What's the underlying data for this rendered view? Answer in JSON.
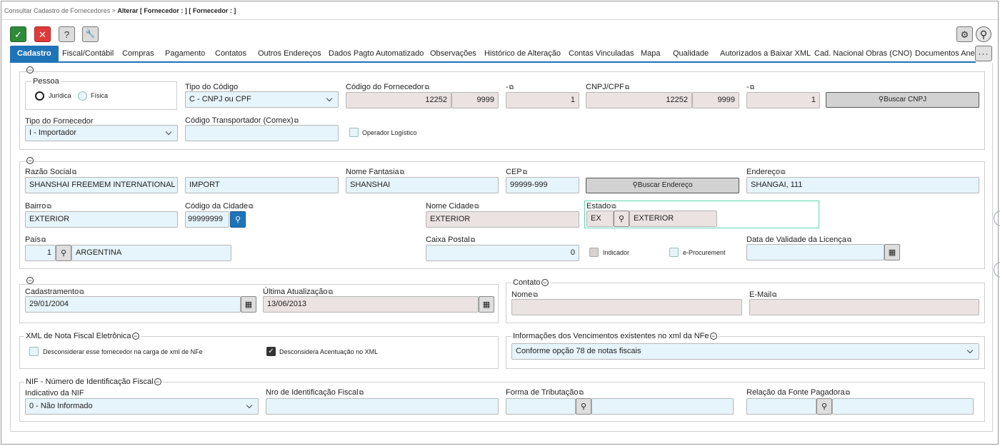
{
  "breadcrumb": {
    "parent": "Consultar Cadastro de Fornecedores",
    "separator": ">",
    "current": "Alterar [ Fornecedor : ] [ Fornecedor : ]"
  },
  "toolbar": {
    "confirm_glyph": "✓",
    "cancel_glyph": "✕",
    "help_glyph": "?",
    "tools_glyph": "🔧",
    "settings_glyph": "⚙",
    "search_glyph": "⚲"
  },
  "tabs": [
    {
      "label": "Cadastro",
      "active": true
    },
    {
      "label": "Fiscal/Contábil"
    },
    {
      "label": "Compras"
    },
    {
      "label": "Pagamento"
    },
    {
      "label": "Contatos"
    },
    {
      "label": "Outros Endereços"
    },
    {
      "label": "Dados Pagto Automatizado"
    },
    {
      "label": "Observações"
    },
    {
      "label": "Histórico de Alteração"
    },
    {
      "label": "Contas Vinculadas"
    },
    {
      "label": "Mapa"
    },
    {
      "label": "Qualidade"
    },
    {
      "label": "Autorizados a Baixar XML"
    },
    {
      "label": "Cad. Nacional Obras (CNO)"
    },
    {
      "label": "Documentos Anexo"
    }
  ],
  "tab_more": "···",
  "pessoa": {
    "title": "Pessoa",
    "juridica": "Jurídica",
    "fisica": "Física"
  },
  "tipo_codigo": {
    "label": "Tipo do Código",
    "value": "C - CNPJ ou CPF"
  },
  "codigo_fornecedor": {
    "label": "Código do Fornecedor",
    "part1": "12252",
    "part2": "9999"
  },
  "digito1": {
    "label": "-",
    "value": "1"
  },
  "cnpj": {
    "label": "CNPJ/CPF",
    "part1": "12252",
    "part2": "9999"
  },
  "digito2": {
    "label": "-",
    "value": "1"
  },
  "buscar_cnpj": "Buscar CNPJ",
  "tipo_fornecedor": {
    "label": "Tipo do Fornecedor",
    "value": "I - Importador"
  },
  "codigo_transportador": {
    "label": "Código Transportador (Comex)",
    "value": ""
  },
  "operador_logistico": "Operador Logístico",
  "razao_social": {
    "label": "Razão Social",
    "value": "SHANSHAI FREEMEM INTERNATIONAL",
    "value2": "IMPORT"
  },
  "nome_fantasia": {
    "label": "Nome Fantasia",
    "value": "SHANSHAI"
  },
  "cep": {
    "label": "CEP",
    "value": "99999-999"
  },
  "buscar_endereco": "Buscar Endereço",
  "endereco": {
    "label": "Endereço",
    "value": "SHANGAI, 111"
  },
  "bairro": {
    "label": "Bairro",
    "value": "EXTERIOR"
  },
  "codigo_cidade": {
    "label": "Código da Cidade",
    "value": "99999999"
  },
  "nome_cidade": {
    "label": "Nome Cidade",
    "value": "EXTERIOR"
  },
  "estado": {
    "label": "Estado",
    "code": "EX",
    "name": "EXTERIOR"
  },
  "pais": {
    "label": "País",
    "code": "1",
    "name": "ARGENTINA"
  },
  "caixa_postal": {
    "label": "Caixa Postal",
    "value": "0"
  },
  "indicador": "Indicador",
  "e_procurement": "e-Procurement",
  "data_validade": {
    "label": "Data de Validade da Licença",
    "value": ""
  },
  "cadastramento": {
    "label": "Cadastramento",
    "value": "29/01/2004"
  },
  "ultima_atualizacao": {
    "label": "Última Atualização",
    "value": "13/06/2013"
  },
  "contato": {
    "title": "Contato",
    "nome_label": "Nome",
    "nome": "",
    "email_label": "E-Mail",
    "email": ""
  },
  "xml_nfe": {
    "title": "XML de Nota Fiscal Eletrônica",
    "desconsiderar": "Desconsiderar esse fornecedor na carga de xml de NFe",
    "acentuacao": "Desconsidera Acentuação no XML"
  },
  "vencimentos": {
    "title": "Informações dos Vencimentos existentes no xml da NFe",
    "value": "Conforme opção 78 de notas fiscais"
  },
  "nif": {
    "title": "NIF - Número de Identificação Fiscal",
    "indicativo_label": "Indicativo da NIF",
    "indicativo_value": "0 - Não Informado",
    "nro_label": "Nro de Identificação Fiscal",
    "forma_label": "Forma de Tributação",
    "relacao_label": "Relação da Fonte Pagadora"
  }
}
